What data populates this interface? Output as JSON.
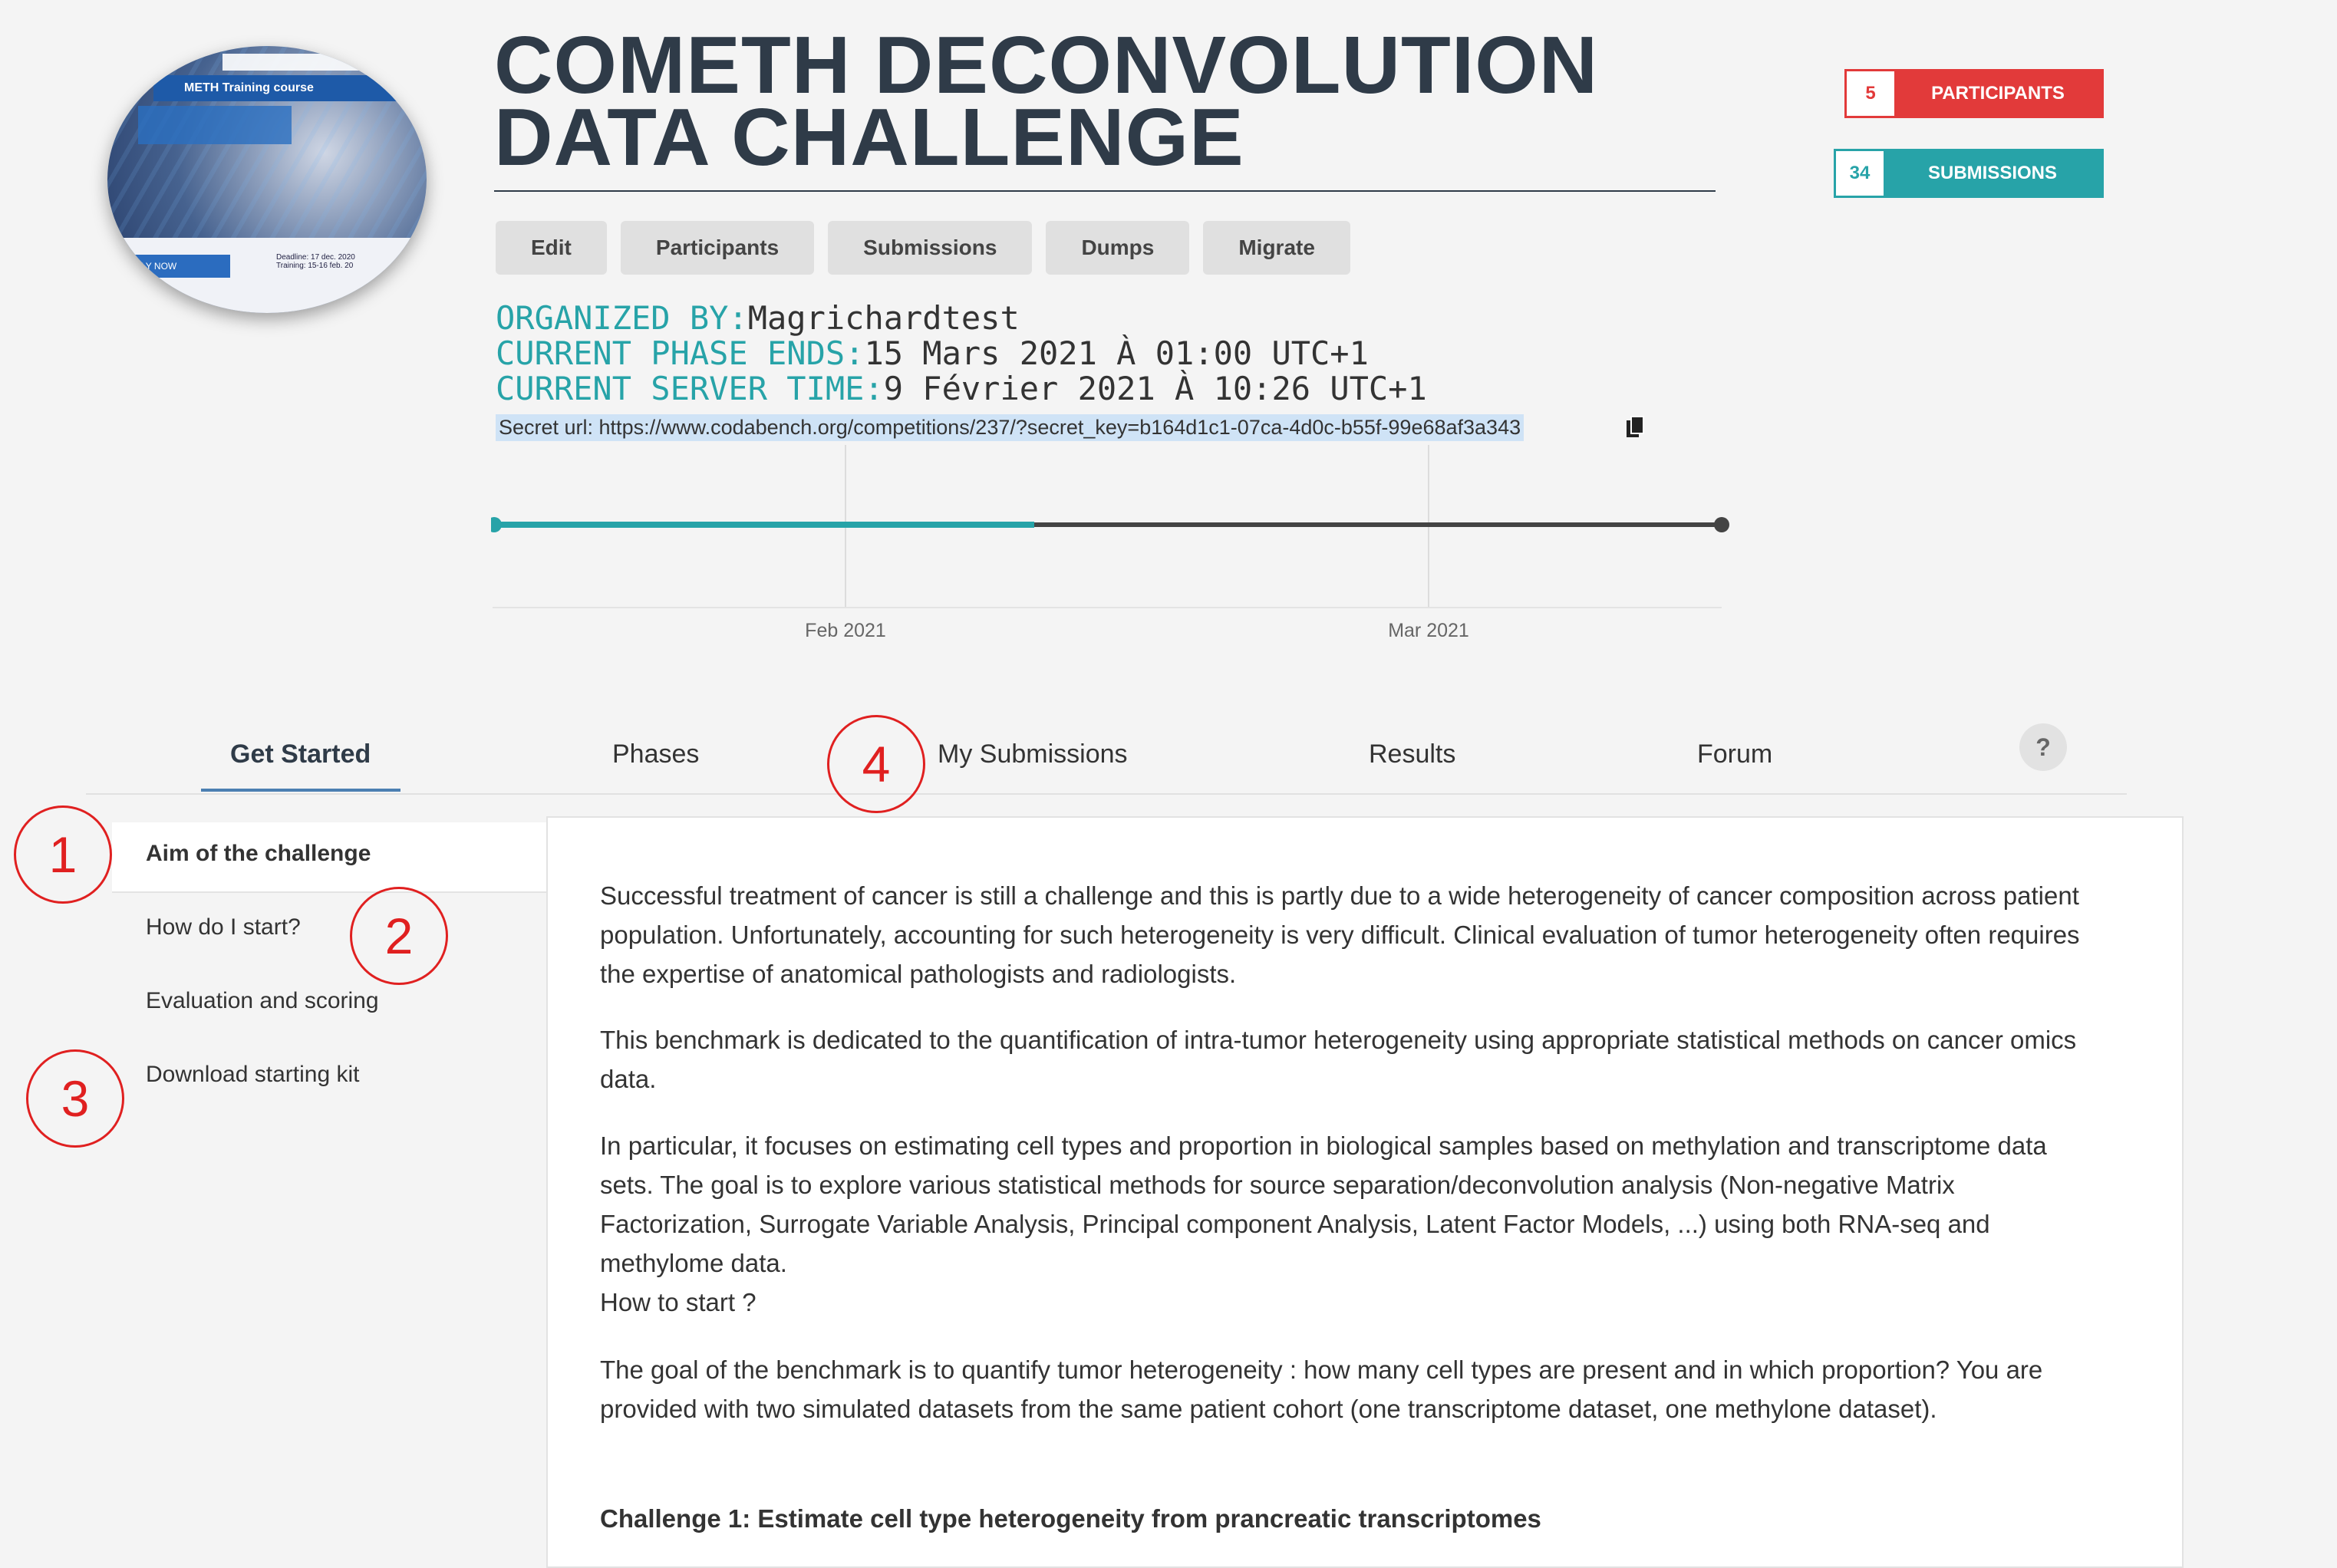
{
  "logo": {
    "banner": "METH Training course",
    "apply": "PPLY NOW",
    "deadline_label": "Deadline: 17 dec. 2020",
    "training_label": "Training: 15-16 feb. 20"
  },
  "header": {
    "title_line1": "COMETH DECONVOLUTION",
    "title_line2": "DATA CHALLENGE",
    "participants_count": "5",
    "participants_label": "PARTICIPANTS",
    "submissions_count": "34",
    "submissions_label": "SUBMISSIONS"
  },
  "admin_buttons": [
    "Edit",
    "Participants",
    "Submissions",
    "Dumps",
    "Migrate"
  ],
  "info": {
    "organized_by_key": "ORGANIZED BY:",
    "organized_by_val": "Magrichardtest",
    "phase_ends_key": "CURRENT PHASE ENDS:",
    "phase_ends_val": "15 Mars 2021 À 01:00 UTC+1",
    "server_time_key": "CURRENT SERVER TIME:",
    "server_time_val": "9 Février 2021 À 10:26 UTC+1",
    "secret_url": "Secret url: https://www.codabench.org/competitions/237/?secret_key=b164d1c1-07ca-4d0c-b55f-99e68af3a343"
  },
  "timeline": {
    "ticks": [
      "Feb 2021",
      "Mar 2021"
    ],
    "progress_fraction": 0.44
  },
  "tabs": [
    "Get Started",
    "Phases",
    "My Submissions",
    "Results",
    "Forum"
  ],
  "help_label": "?",
  "sidebar": [
    "Aim of the challenge",
    "How do I start?",
    "Evaluation and scoring",
    "Download starting kit"
  ],
  "content": {
    "p1": "Successful treatment of cancer is still a challenge and this is partly due to a wide heterogeneity of cancer composition across patient population. Unfortunately, accounting for such heterogeneity is very difficult. Clinical evaluation of tumor heterogeneity often requires the expertise of anatomical pathologists and radiologists.",
    "p2": "This benchmark is dedicated to the quantification of intra-tumor heterogeneity using appropriate statistical methods on cancer omics data.",
    "p3": "In particular, it focuses on estimating cell types and proportion in biological samples based on methylation and transcriptome data sets. The goal is to explore various statistical methods for source separation/deconvolution analysis (Non-negative Matrix Factorization, Surrogate Variable Analysis, Principal component Analysis, Latent Factor Models, ...) using both RNA-seq and methylome data.",
    "p3b": "How to start ?",
    "p4": "The goal of the benchmark is to quantify tumor heterogeneity : how many cell types are present and in which proportion? You are provided with two simulated datasets from the same patient cohort (one transcriptome dataset, one methylone dataset).",
    "p5": "Challenge 1: Estimate cell type heterogeneity from prancreatic transcriptomes"
  },
  "markers": [
    "1",
    "2",
    "3",
    "4"
  ],
  "colors": {
    "accent": "#27a3a8",
    "danger": "#e23a3a",
    "marker": "#e02020",
    "title": "#2f3b48"
  }
}
